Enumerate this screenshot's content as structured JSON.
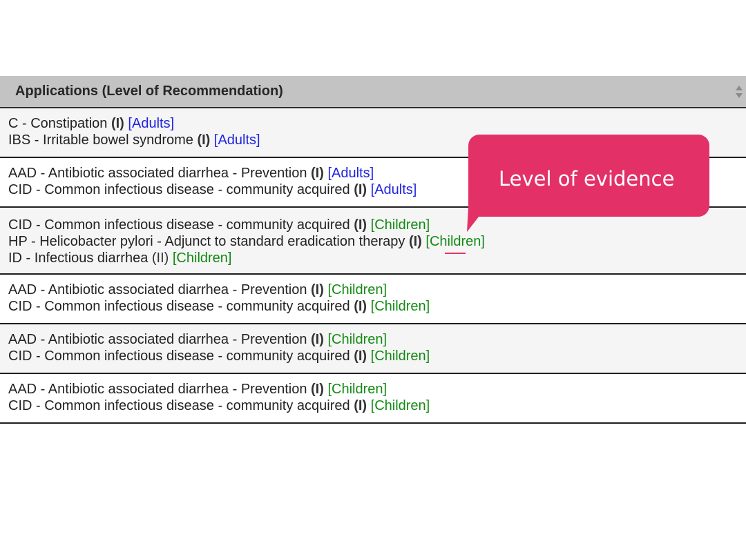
{
  "table": {
    "header": "Applications (Level of Recommendation)",
    "sort_icon": "sort-arrows-icon",
    "rows": [
      {
        "lines": [
          {
            "text": "C - Constipation ",
            "level": "(I)",
            "level_bold": true,
            "population": "[Adults]",
            "pop_type": "adults"
          },
          {
            "text": "IBS - Irritable bowel syndrome ",
            "level": "(I)",
            "level_bold": true,
            "population": "[Adults]",
            "pop_type": "adults"
          }
        ]
      },
      {
        "lines": [
          {
            "text": "AAD - Antibiotic associated diarrhea - Prevention ",
            "level": "(I)",
            "level_bold": true,
            "population": "[Adults]",
            "pop_type": "adults"
          },
          {
            "text": "CID - Common infectious disease - community acquired ",
            "level": "(I)",
            "level_bold": true,
            "population": "[Adults]",
            "pop_type": "adults"
          }
        ]
      },
      {
        "lines": [
          {
            "text": "CID - Common infectious disease - community acquired ",
            "level": "(I)",
            "level_bold": true,
            "population": "[Children]",
            "pop_type": "children"
          },
          {
            "text": "HP - Helicobacter pylori - Adjunct to standard eradication therapy ",
            "level": "(I)",
            "level_bold": true,
            "population": "[Children]",
            "pop_type": "children"
          },
          {
            "text": "ID - Infectious diarrhea ",
            "level": "(II)",
            "level_bold": false,
            "population": "[Children]",
            "pop_type": "children"
          }
        ]
      },
      {
        "lines": [
          {
            "text": "AAD - Antibiotic associated diarrhea - Prevention ",
            "level": "(I)",
            "level_bold": true,
            "population": "[Children]",
            "pop_type": "children"
          },
          {
            "text": "CID - Common infectious disease - community acquired ",
            "level": "(I)",
            "level_bold": true,
            "population": "[Children]",
            "pop_type": "children"
          }
        ]
      },
      {
        "lines": [
          {
            "text": "AAD - Antibiotic associated diarrhea - Prevention ",
            "level": "(I)",
            "level_bold": true,
            "population": "[Children]",
            "pop_type": "children"
          },
          {
            "text": "CID - Common infectious disease - community acquired ",
            "level": "(I)",
            "level_bold": true,
            "population": "[Children]",
            "pop_type": "children"
          }
        ]
      },
      {
        "lines": [
          {
            "text": "AAD - Antibiotic associated diarrhea - Prevention ",
            "level": "(I)",
            "level_bold": true,
            "population": "[Children]",
            "pop_type": "children"
          },
          {
            "text": "CID - Common infectious disease - community acquired ",
            "level": "(I)",
            "level_bold": true,
            "population": "[Children]",
            "pop_type": "children"
          }
        ]
      }
    ]
  },
  "callout": {
    "text": "Level of evidence",
    "color": "#e33168"
  },
  "colors": {
    "adults": "#1f24e0",
    "children": "#138a13",
    "header_bg": "#c3c3c3"
  }
}
